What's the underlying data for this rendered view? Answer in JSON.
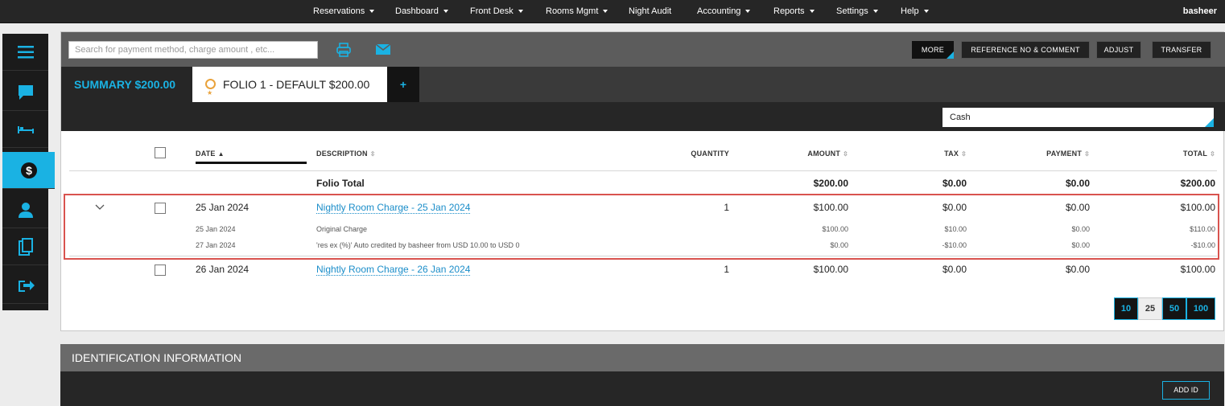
{
  "nav": {
    "items": [
      "Reservations",
      "Dashboard",
      "Front Desk",
      "Rooms Mgmt",
      "Night Audit",
      "Accounting",
      "Reports",
      "Settings",
      "Help"
    ],
    "user": "basheer"
  },
  "sidebar": {
    "icons": [
      "menu-icon",
      "chat-icon",
      "bed-icon",
      "dollar-icon",
      "person-icon",
      "documents-icon",
      "checkout-icon"
    ],
    "active": "dollar-icon"
  },
  "toolbar": {
    "search_placeholder": "Search for payment method, charge amount , etc...",
    "more": "MORE",
    "reference": "REFERENCE NO & COMMENT",
    "adjust": "ADJUST",
    "transfer": "TRANSFER"
  },
  "tabs": {
    "summary": "SUMMARY $200.00",
    "folio": "FOLIO 1 - DEFAULT $200.00",
    "add": "+"
  },
  "filter": {
    "payment_method": "Cash"
  },
  "table": {
    "headers": {
      "date": "DATE",
      "description": "DESCRIPTION",
      "quantity": "QUANTITY",
      "amount": "AMOUNT",
      "tax": "TAX",
      "payment": "PAYMENT",
      "total": "TOTAL"
    },
    "folio_total": {
      "label": "Folio Total",
      "amount": "$200.00",
      "tax": "$0.00",
      "payment": "$0.00",
      "total": "$200.00"
    },
    "rows": [
      {
        "date": "25 Jan 2024",
        "description": "Nightly Room Charge - 25 Jan 2024",
        "quantity": "1",
        "amount": "$100.00",
        "tax": "$0.00",
        "payment": "$0.00",
        "total": "$100.00",
        "details": [
          {
            "date": "25 Jan 2024",
            "description": "Original Charge",
            "amount": "$100.00",
            "tax": "$10.00",
            "payment": "$0.00",
            "total": "$110.00"
          },
          {
            "date": "27 Jan 2024",
            "description": "'res ex (%)' Auto credited by basheer from USD 10.00 to USD 0",
            "amount": "$0.00",
            "tax": "-$10.00",
            "payment": "$0.00",
            "total": "-$10.00"
          }
        ]
      },
      {
        "date": "26 Jan 2024",
        "description": "Nightly Room Charge - 26 Jan 2024",
        "quantity": "1",
        "amount": "$100.00",
        "tax": "$0.00",
        "payment": "$0.00",
        "total": "$100.00"
      }
    ]
  },
  "pagination": {
    "options": [
      "10",
      "25",
      "50",
      "100"
    ],
    "selected": "25"
  },
  "identification": {
    "title": "IDENTIFICATION INFORMATION",
    "add_button": "ADD ID"
  },
  "colors": {
    "accent": "#1ab2e3",
    "highlight": "#d9534f",
    "dark": "#262626"
  }
}
